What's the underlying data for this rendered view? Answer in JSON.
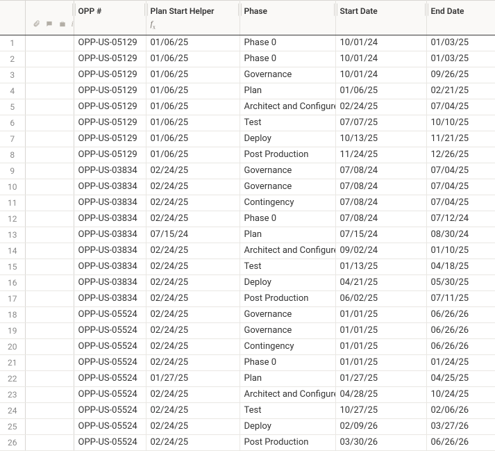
{
  "columns": {
    "opp": "OPP #",
    "helper": "Plan Start Helper",
    "phase": "Phase",
    "start": "Start Date",
    "end": "End Date"
  },
  "header_icons": {
    "attachment": "attachment-icon",
    "comment": "comment-icon",
    "briefcase": "briefcase-icon",
    "info": "info-icon"
  },
  "formula_hint": "fx",
  "rows": [
    {
      "n": "1",
      "opp": "OPP-US-05129",
      "helper": "01/06/25",
      "phase": "Phase 0",
      "start": "10/01/24",
      "end": "01/03/25"
    },
    {
      "n": "2",
      "opp": "OPP-US-05129",
      "helper": "01/06/25",
      "phase": "Phase 0",
      "start": "10/01/24",
      "end": "01/03/25"
    },
    {
      "n": "3",
      "opp": "OPP-US-05129",
      "helper": "01/06/25",
      "phase": "Governance",
      "start": "10/01/24",
      "end": "09/26/25"
    },
    {
      "n": "4",
      "opp": "OPP-US-05129",
      "helper": "01/06/25",
      "phase": "Plan",
      "start": "01/06/25",
      "end": "02/21/25"
    },
    {
      "n": "5",
      "opp": "OPP-US-05129",
      "helper": "01/06/25",
      "phase": "Architect and Configure",
      "start": "02/24/25",
      "end": "07/04/25"
    },
    {
      "n": "6",
      "opp": "OPP-US-05129",
      "helper": "01/06/25",
      "phase": "Test",
      "start": "07/07/25",
      "end": "10/10/25"
    },
    {
      "n": "7",
      "opp": "OPP-US-05129",
      "helper": "01/06/25",
      "phase": "Deploy",
      "start": "10/13/25",
      "end": "11/21/25"
    },
    {
      "n": "8",
      "opp": "OPP-US-05129",
      "helper": "01/06/25",
      "phase": "Post Production",
      "start": "11/24/25",
      "end": "12/26/25"
    },
    {
      "n": "9",
      "opp": "OPP-US-03834",
      "helper": "02/24/25",
      "phase": "Governance",
      "start": "07/08/24",
      "end": "07/04/25"
    },
    {
      "n": "10",
      "opp": "OPP-US-03834",
      "helper": "02/24/25",
      "phase": "Governance",
      "start": "07/08/24",
      "end": "07/04/25"
    },
    {
      "n": "11",
      "opp": "OPP-US-03834",
      "helper": "02/24/25",
      "phase": "Contingency",
      "start": "07/08/24",
      "end": "07/04/25"
    },
    {
      "n": "12",
      "opp": "OPP-US-03834",
      "helper": "02/24/25",
      "phase": "Phase 0",
      "start": "07/08/24",
      "end": "07/12/24"
    },
    {
      "n": "13",
      "opp": "OPP-US-03834",
      "helper": "07/15/24",
      "phase": "Plan",
      "start": "07/15/24",
      "end": "08/30/24"
    },
    {
      "n": "14",
      "opp": "OPP-US-03834",
      "helper": "02/24/25",
      "phase": "Architect and Configure",
      "start": "09/02/24",
      "end": "01/10/25"
    },
    {
      "n": "15",
      "opp": "OPP-US-03834",
      "helper": "02/24/25",
      "phase": "Test",
      "start": "01/13/25",
      "end": "04/18/25"
    },
    {
      "n": "16",
      "opp": "OPP-US-03834",
      "helper": "02/24/25",
      "phase": "Deploy",
      "start": "04/21/25",
      "end": "05/30/25"
    },
    {
      "n": "17",
      "opp": "OPP-US-03834",
      "helper": "02/24/25",
      "phase": "Post Production",
      "start": "06/02/25",
      "end": "07/11/25"
    },
    {
      "n": "18",
      "opp": "OPP-US-05524",
      "helper": "02/24/25",
      "phase": "Governance",
      "start": "01/01/25",
      "end": "06/26/26"
    },
    {
      "n": "19",
      "opp": "OPP-US-05524",
      "helper": "02/24/25",
      "phase": "Governance",
      "start": "01/01/25",
      "end": "06/26/26"
    },
    {
      "n": "20",
      "opp": "OPP-US-05524",
      "helper": "02/24/25",
      "phase": "Contingency",
      "start": "01/01/25",
      "end": "06/26/26"
    },
    {
      "n": "21",
      "opp": "OPP-US-05524",
      "helper": "02/24/25",
      "phase": "Phase 0",
      "start": "01/01/25",
      "end": "01/24/25"
    },
    {
      "n": "22",
      "opp": "OPP-US-05524",
      "helper": "01/27/25",
      "phase": "Plan",
      "start": "01/27/25",
      "end": "04/25/25"
    },
    {
      "n": "23",
      "opp": "OPP-US-05524",
      "helper": "02/24/25",
      "phase": "Architect and Configure",
      "start": "04/28/25",
      "end": "10/24/25"
    },
    {
      "n": "24",
      "opp": "OPP-US-05524",
      "helper": "02/24/25",
      "phase": "Test",
      "start": "10/27/25",
      "end": "02/06/26"
    },
    {
      "n": "25",
      "opp": "OPP-US-05524",
      "helper": "02/24/25",
      "phase": "Deploy",
      "start": "02/09/26",
      "end": "03/27/26"
    },
    {
      "n": "26",
      "opp": "OPP-US-05524",
      "helper": "02/24/25",
      "phase": "Post Production",
      "start": "03/30/26",
      "end": "06/26/26"
    }
  ]
}
